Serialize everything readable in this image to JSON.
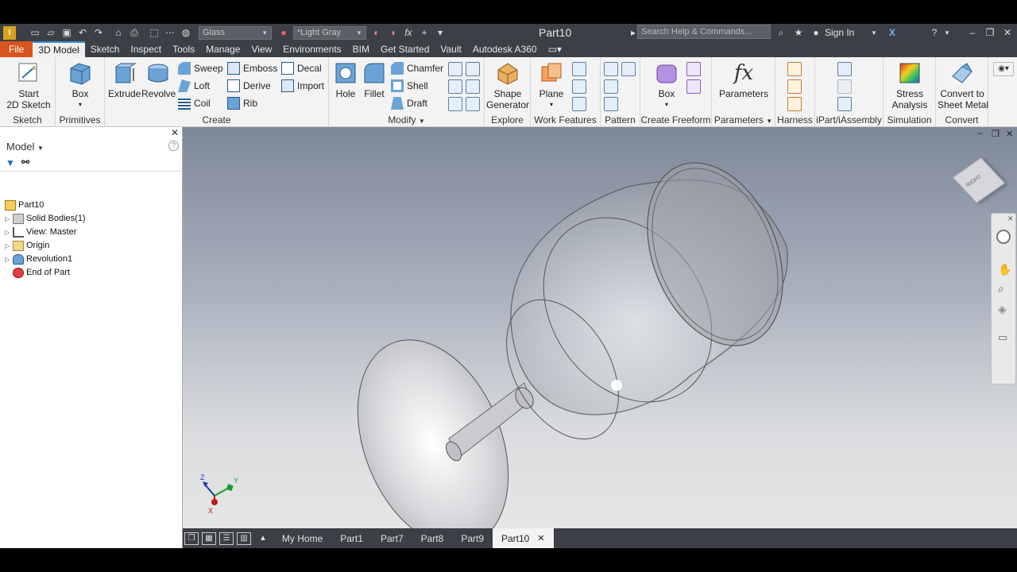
{
  "app": {
    "title": "Part10"
  },
  "qat": {
    "material": "Glass",
    "appearance": "*Light Gray",
    "search_placeholder": "Search Help & Commands...",
    "sign_in": "Sign In"
  },
  "tabs": [
    "File",
    "3D Model",
    "Sketch",
    "Inspect",
    "Tools",
    "Manage",
    "View",
    "Environments",
    "BIM",
    "Get Started",
    "Vault",
    "Autodesk A360"
  ],
  "ribbon": {
    "sketch": {
      "start_line1": "Start",
      "start_line2": "2D Sketch",
      "label": "Sketch"
    },
    "primitives": {
      "box": "Box",
      "label": "Primitives"
    },
    "create": {
      "extrude": "Extrude",
      "revolve": "Revolve",
      "sweep": "Sweep",
      "loft": "Loft",
      "coil": "Coil",
      "emboss": "Emboss",
      "derive": "Derive",
      "rib": "Rib",
      "decal": "Decal",
      "import": "Import",
      "label": "Create"
    },
    "modify": {
      "hole": "Hole",
      "fillet": "Fillet",
      "chamfer": "Chamfer",
      "shell": "Shell",
      "draft": "Draft",
      "label": "Modify"
    },
    "explore": {
      "line1": "Shape",
      "line2": "Generator",
      "label": "Explore"
    },
    "work": {
      "plane": "Plane",
      "label": "Work Features"
    },
    "pattern": {
      "label": "Pattern"
    },
    "freeform": {
      "box": "Box",
      "label": "Create Freeform"
    },
    "parameters": {
      "btn": "Parameters",
      "label": "Parameters"
    },
    "harness": {
      "label": "Harness"
    },
    "ipart": {
      "label": "iPart/iAssembly"
    },
    "simulation": {
      "line1": "Stress",
      "line2": "Analysis",
      "label": "Simulation"
    },
    "convert": {
      "line1": "Convert to",
      "line2": "Sheet Metal",
      "label": "Convert"
    }
  },
  "browser": {
    "header": "Model",
    "items": [
      {
        "label": "Part10"
      },
      {
        "label": "Solid Bodies(1)"
      },
      {
        "label": "View: Master"
      },
      {
        "label": "Origin"
      },
      {
        "label": "Revolution1"
      },
      {
        "label": "End of Part"
      }
    ]
  },
  "viewcube": {
    "face": "RIGHT"
  },
  "axes": {
    "x": "X",
    "y": "Y",
    "z": "Z"
  },
  "doc_tabs": [
    "My Home",
    "Part1",
    "Part7",
    "Part8",
    "Part9",
    "Part10"
  ],
  "colors": {
    "accent": "#d9541e",
    "titlebar": "#3c3f45",
    "selection": "#3a8fd8"
  }
}
